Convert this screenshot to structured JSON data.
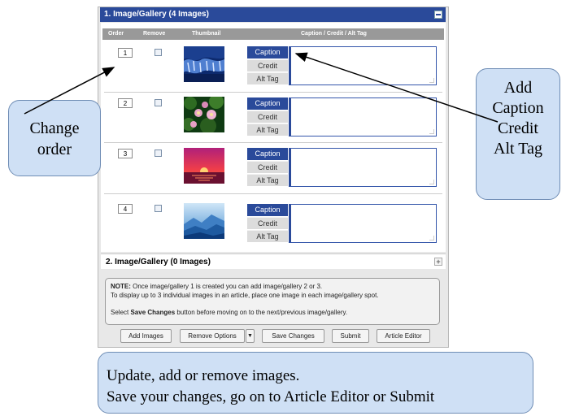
{
  "section1": {
    "title": "1. Image/Gallery (4 Images)"
  },
  "columns": {
    "order": "Order",
    "remove": "Remove",
    "thumbnail": "Thumbnail",
    "caption": "Caption / Credit / Alt Tag"
  },
  "rows": [
    {
      "order": "1",
      "thumbnail": "waterfall thumbnail",
      "buttons": [
        "Caption",
        "Credit",
        "Alt Tag"
      ]
    },
    {
      "order": "2",
      "thumbnail": "lotus flowers thumbnail",
      "buttons": [
        "Caption",
        "Credit",
        "Alt Tag"
      ]
    },
    {
      "order": "3",
      "thumbnail": "sunset thumbnail",
      "buttons": [
        "Caption",
        "Credit",
        "Alt Tag"
      ]
    },
    {
      "order": "4",
      "thumbnail": "blue mountains thumbnail",
      "buttons": [
        "Caption",
        "Credit",
        "Alt Tag"
      ]
    }
  ],
  "section2": {
    "title": "2. Image/Gallery (0 Images)"
  },
  "note": {
    "label": "NOTE:",
    "line1": " Once image/gallery 1 is created you can add image/gallery 2 or 3.",
    "line2": "To display up to 3 individual images in an article, place one image in each image/gallery spot.",
    "line3a": "Select ",
    "line3b": "Save Changes",
    "line3c": " button before moving on to the next/previous image/gallery."
  },
  "buttons": {
    "add_images": "Add Images",
    "remove_options": "Remove Options",
    "save_changes": "Save Changes",
    "submit": "Submit",
    "article_editor": "Article Editor"
  },
  "callouts": {
    "left": [
      "Change",
      "order"
    ],
    "right": [
      "Add",
      "Caption",
      "Credit",
      "Alt Tag"
    ],
    "bottom": [
      "Update, add or remove images.",
      "Save your changes, go on to Article Editor or Submit"
    ]
  },
  "colors": {
    "header": "#2a4a9a",
    "callout_fill": "#cfe0f5",
    "callout_border": "#6f8db5"
  }
}
